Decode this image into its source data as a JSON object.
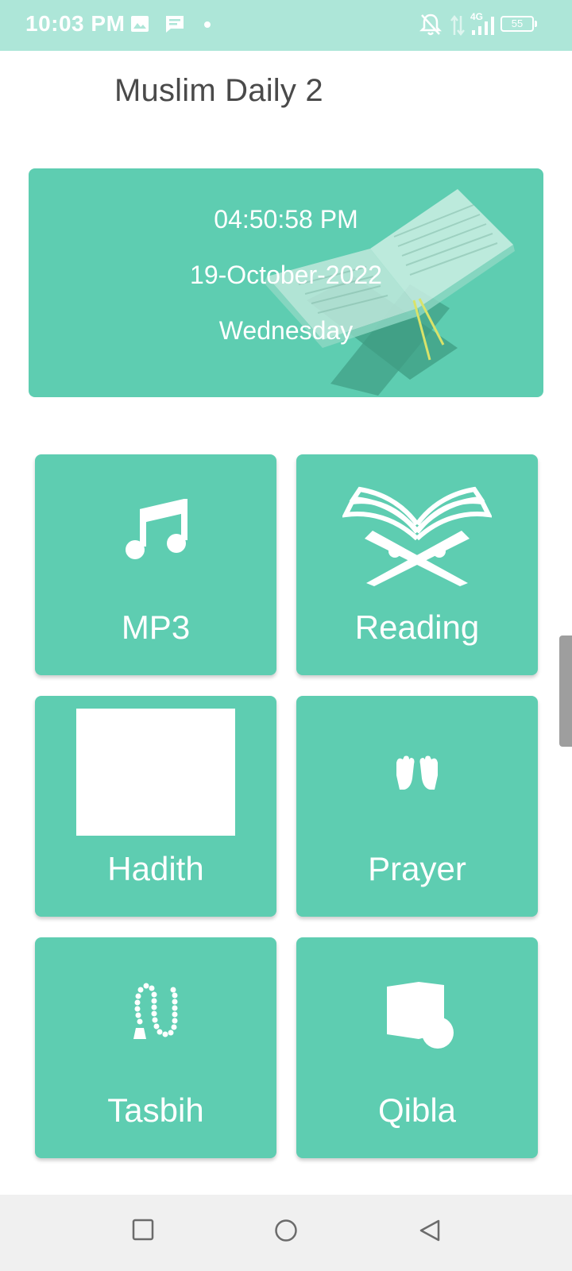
{
  "status_bar": {
    "time": "10:03 PM",
    "network": "4G",
    "battery": "55",
    "icons": [
      "image-icon",
      "message-icon",
      "dot-icon",
      "bell-off-icon",
      "data-arrows-icon",
      "signal-icon",
      "battery-icon"
    ]
  },
  "app": {
    "title": "Muslim Daily 2"
  },
  "date_card": {
    "time": "04:50:58 PM",
    "date": "19-October-2022",
    "day": "Wednesday"
  },
  "menu": [
    {
      "label": "MP3",
      "icon": "music-note-icon"
    },
    {
      "label": "Reading",
      "icon": "quran-stand-icon"
    },
    {
      "label": "Hadith",
      "icon": "hadith-image-icon"
    },
    {
      "label": "Prayer",
      "icon": "praying-hands-icon"
    },
    {
      "label": "Tasbih",
      "icon": "tasbih-beads-icon"
    },
    {
      "label": "Qibla",
      "icon": "kaaba-icon"
    }
  ],
  "colors": {
    "status_bar": "#ade6d8",
    "accent": "#5ecdb1",
    "title_text": "#4a4a4a",
    "nav_bar": "#f0f0f0"
  }
}
